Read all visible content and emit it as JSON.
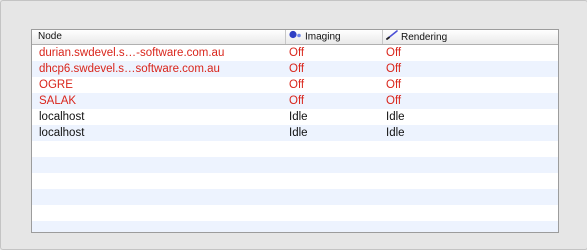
{
  "table": {
    "columns": {
      "node": "Node",
      "imaging": "Imaging",
      "rendering": "Rendering"
    },
    "rows": [
      {
        "node": "durian.swdevel.s…-software.com.au",
        "imaging": "Off",
        "rendering": "Off",
        "status_color": "#d9251b"
      },
      {
        "node": "dhcp6.swdevel.s…software.com.au",
        "imaging": "Off",
        "rendering": "Off",
        "status_color": "#d9251b"
      },
      {
        "node": "OGRE",
        "imaging": "Off",
        "rendering": "Off",
        "status_color": "#d9251b"
      },
      {
        "node": "SALAK",
        "imaging": "Off",
        "rendering": "Off",
        "status_color": "#d9251b"
      },
      {
        "node": "localhost",
        "imaging": "Idle",
        "rendering": "Idle",
        "status_color": "#111111"
      },
      {
        "node": "localhost",
        "imaging": "Idle",
        "rendering": "Idle",
        "status_color": "#111111"
      }
    ],
    "icons": {
      "imaging": "imaging-icon",
      "rendering": "rendering-icon"
    }
  }
}
